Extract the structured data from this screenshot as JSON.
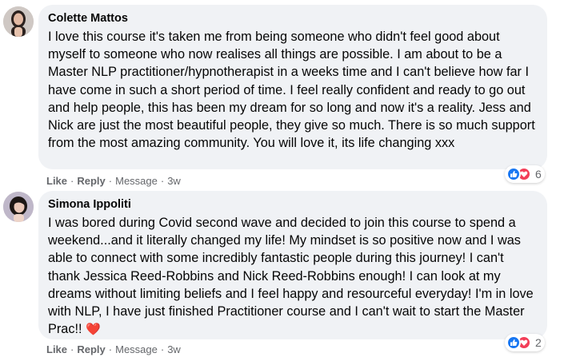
{
  "comments": [
    {
      "author": "Colette Mattos",
      "text": "I love this course it's taken me from being someone who didn't feel good about myself to someone who now realises all things are possible. I am about to be a Master NLP practitioner/hypnotherapist in a weeks time and I can't believe how far I have come in such a short period of time. I feel really confident and ready to go out and help people, this has been my dream for so long and now it's a reality. Jess and Nick are just the most beautiful people, they give so much. There is so much support from the most amazing community. You will love it, its life changing xxx",
      "emoji": "",
      "like_label": "Like",
      "reply_label": "Reply",
      "message_label": "Message",
      "time": "3w",
      "reaction_count": "6",
      "reaction_icons": [
        "like-icon",
        "love-icon"
      ]
    },
    {
      "author": "Simona Ippoliti",
      "text": "I was bored during Covid second wave and decided to join this course to spend a weekend...and it literally changed my life! My mindset is so positive now and I was able to connect with some incredibly fantastic people during this journey! I can't thank Jessica Reed-Robbins and Nick Reed-Robbins enough! I can look at my dreams without limiting beliefs and I feel happy and resourceful everyday! I'm in love with NLP, I have just finished Practitioner course and I can't wait to start the Master Prac!! ",
      "emoji": "❤️",
      "like_label": "Like",
      "reply_label": "Reply",
      "message_label": "Message",
      "time": "3w",
      "reaction_count": "2",
      "reaction_icons": [
        "like-icon",
        "love-icon"
      ]
    }
  ],
  "separator": "·",
  "colors": {
    "bubble": "#f0f2f5",
    "meta": "#65676b",
    "like": "#1877f2",
    "love": "#f33e58"
  }
}
